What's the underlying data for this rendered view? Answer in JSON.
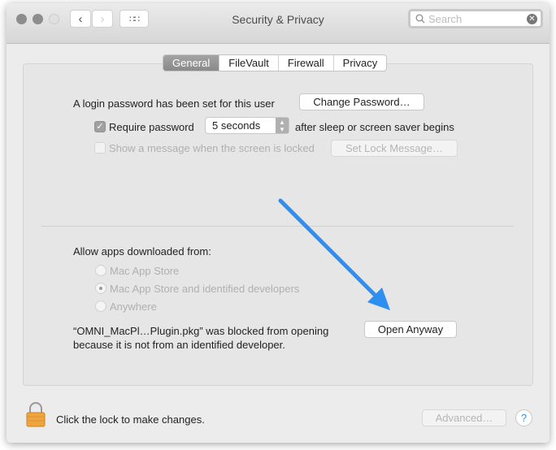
{
  "window": {
    "title": "Security & Privacy"
  },
  "toolbar": {
    "back_icon": "chevron-left-icon",
    "forward_icon": "chevron-right-icon",
    "grid_icon": "grid-icon"
  },
  "search": {
    "placeholder": "Search",
    "value": ""
  },
  "tabs": [
    {
      "label": "General",
      "active": true
    },
    {
      "label": "FileVault"
    },
    {
      "label": "Firewall"
    },
    {
      "label": "Privacy"
    }
  ],
  "general": {
    "login_text": "A login password has been set for this user",
    "change_password": "Change Password…",
    "require_password_label": "Require password",
    "require_password_checked": true,
    "require_delay": "5 seconds",
    "after_text": "after sleep or screen saver begins",
    "show_message_label": "Show a message when the screen is locked",
    "show_message_checked": false,
    "set_lock_message": "Set Lock Message…",
    "allow_label": "Allow apps downloaded from:",
    "options": [
      "Mac App Store",
      "Mac App Store and identified developers",
      "Anywhere"
    ],
    "selected_option": "Mac App Store and identified developers",
    "blocked_line1": "“OMNI_MacPl…Plugin.pkg” was blocked from opening",
    "blocked_line2": "because it is not from an identified developer.",
    "open_anyway": "Open Anyway"
  },
  "annotation": {
    "arrow_color": "#2f8ff0"
  },
  "footer": {
    "lock_text": "Click the lock to make changes.",
    "advanced": "Advanced…",
    "help": "?"
  }
}
